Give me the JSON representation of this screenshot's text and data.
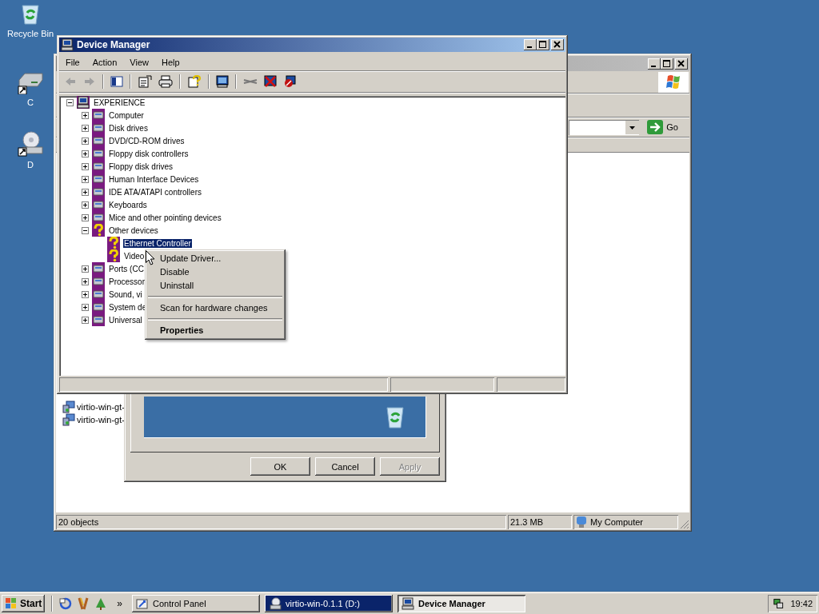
{
  "desktop_icons": [
    {
      "label": "Recycle Bin",
      "kind": "recycle"
    },
    {
      "label": "C",
      "kind": "drive"
    },
    {
      "label": "D",
      "kind": "cd"
    }
  ],
  "explorer_window": {
    "go_label": "Go",
    "items": [
      "virtio-win-gt-",
      "virtio-win-gt-"
    ],
    "status_bar": [
      "20 objects",
      "21.3 MB",
      "My Computer"
    ]
  },
  "properties_dialog": {
    "buttons": [
      {
        "label": "OK",
        "disabled": false
      },
      {
        "label": "Cancel",
        "disabled": false
      },
      {
        "label": "Apply",
        "disabled": true
      }
    ]
  },
  "device_manager": {
    "title": "Device Manager",
    "menu": [
      "File",
      "Action",
      "View",
      "Help"
    ],
    "tree": {
      "label": "EXPERIENCE",
      "kind": "computer",
      "expanded": true,
      "selected": false,
      "children": [
        {
          "label": "Computer",
          "kind": "device",
          "expanded": false,
          "selected": false
        },
        {
          "label": "Disk drives",
          "kind": "device",
          "expanded": false,
          "selected": false
        },
        {
          "label": "DVD/CD-ROM drives",
          "kind": "device",
          "expanded": false,
          "selected": false
        },
        {
          "label": "Floppy disk controllers",
          "kind": "device",
          "expanded": false,
          "selected": false
        },
        {
          "label": "Floppy disk drives",
          "kind": "device",
          "expanded": false,
          "selected": false
        },
        {
          "label": "Human Interface Devices",
          "kind": "device",
          "expanded": false,
          "selected": false
        },
        {
          "label": "IDE ATA/ATAPI controllers",
          "kind": "device",
          "expanded": false,
          "selected": false
        },
        {
          "label": "Keyboards",
          "kind": "device",
          "expanded": false,
          "selected": false
        },
        {
          "label": "Mice and other pointing devices",
          "kind": "device",
          "expanded": false,
          "selected": false
        },
        {
          "label": "Other devices",
          "kind": "unknown",
          "expanded": true,
          "selected": false,
          "children": [
            {
              "label": "Ethernet Controller",
              "kind": "unknown",
              "selected": true
            },
            {
              "label": "Video",
              "kind": "unknown",
              "selected": false
            }
          ]
        },
        {
          "label": "Ports (CC",
          "kind": "device",
          "expanded": false,
          "selected": false
        },
        {
          "label": "Processor",
          "kind": "device",
          "expanded": false,
          "selected": false
        },
        {
          "label": "Sound, vi",
          "kind": "device",
          "expanded": false,
          "selected": false
        },
        {
          "label": "System de",
          "kind": "device",
          "expanded": false,
          "selected": false
        },
        {
          "label": "Universal",
          "kind": "device",
          "expanded": false,
          "selected": false
        }
      ]
    },
    "context_menu": [
      {
        "kind": "item",
        "label": "Update Driver...",
        "default": false
      },
      {
        "kind": "item",
        "label": "Disable",
        "default": false
      },
      {
        "kind": "item",
        "label": "Uninstall",
        "default": false
      },
      {
        "kind": "separator"
      },
      {
        "kind": "item",
        "label": "Scan for hardware changes",
        "default": false
      },
      {
        "kind": "separator"
      },
      {
        "kind": "item",
        "label": "Properties",
        "default": true
      }
    ]
  },
  "taskbar": {
    "start": "Start",
    "quick_more": "»",
    "buttons": [
      {
        "label": "Control Panel",
        "kind": "folder",
        "selected": false,
        "flashing": false
      },
      {
        "label": "virtio-win-0.1.1 (D:)",
        "kind": "cd",
        "selected": false,
        "flashing": true
      },
      {
        "label": "Device Manager",
        "kind": "computer",
        "selected": true,
        "flashing": false
      }
    ],
    "clock": "19:42"
  }
}
